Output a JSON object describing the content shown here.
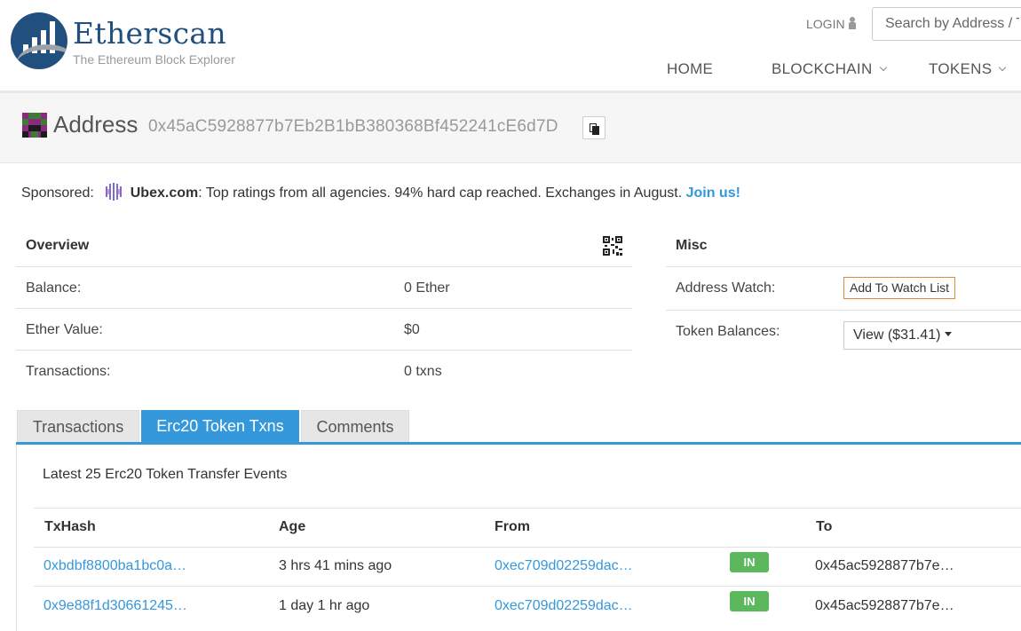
{
  "header": {
    "logo_name": "Etherscan",
    "logo_tagline": "The Ethereum Block Explorer",
    "login_label": "LOGIN",
    "search_placeholder": "Search by Address / Txhash / Block / Token / Ens",
    "nav": [
      "HOME",
      "BLOCKCHAIN",
      "TOKENS"
    ]
  },
  "title": {
    "label": "Address",
    "address": "0x45aC5928877b7Eb2B1bB380368Bf452241cE6d7D"
  },
  "sponsored": {
    "prefix": "Sponsored:",
    "brand": "Ubex.com",
    "text": ": Top ratings from all agencies. 94% hard cap reached. Exchanges in August.",
    "link": "Join us!"
  },
  "overview": {
    "heading": "Overview",
    "rows": [
      {
        "label": "Balance:",
        "value": "0 Ether"
      },
      {
        "label": "Ether Value:",
        "value": "$0"
      },
      {
        "label": "Transactions:",
        "value": "0 txns"
      }
    ]
  },
  "misc": {
    "heading": "Misc",
    "watch_label": "Address Watch:",
    "watch_button": "Add To Watch List",
    "token_label": "Token Balances:",
    "token_value": "View ($31.41)"
  },
  "tabs": [
    {
      "label": "Transactions",
      "active": false
    },
    {
      "label": "Erc20 Token Txns",
      "active": true
    },
    {
      "label": "Comments",
      "active": false
    }
  ],
  "token_txns": {
    "caption": "Latest 25 Erc20 Token Transfer Events",
    "columns": [
      "TxHash",
      "Age",
      "From",
      "To"
    ],
    "rows": [
      {
        "txhash": "0xbdbf8800ba1bc0a…",
        "age": "3 hrs 41 mins ago",
        "from": "0xec709d02259dac…",
        "direction": "IN",
        "to": "0x45ac5928877b7e…"
      },
      {
        "txhash": "0x9e88f1d30661245…",
        "age": "1 day 1 hr ago",
        "from": "0xec709d02259dac…",
        "direction": "IN",
        "to": "0x45ac5928877b7e…"
      }
    ]
  },
  "colors": {
    "brand": "#22507e",
    "accent": "#3498db",
    "in_badge": "#5cb85c",
    "watch_border": "#e08a3c"
  }
}
